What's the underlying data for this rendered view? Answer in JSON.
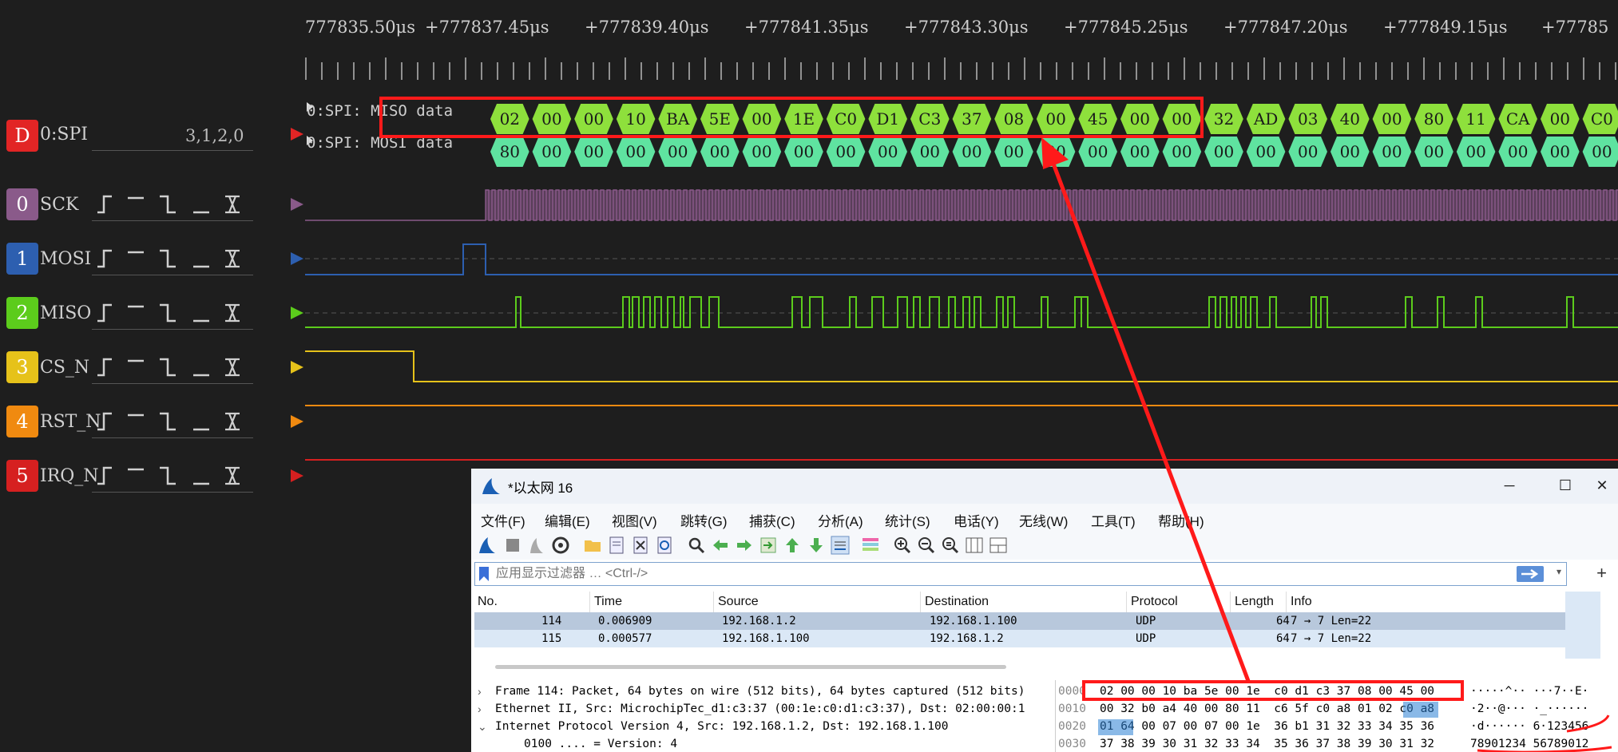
{
  "timeline": {
    "ticks": [
      "777835.50μs",
      "+777837.45μs",
      "+777839.40μs",
      "+777841.35μs",
      "+777843.30μs",
      "+777845.25μs",
      "+777847.20μs",
      "+777849.15μs",
      "+77785"
    ]
  },
  "spi_decoder": {
    "badge": "D",
    "name": "0:SPI",
    "value": "3,1,2,0",
    "miso_label": "0:SPI: MISO data",
    "mosi_label": "0:SPI: MOSI data",
    "miso_bytes": [
      "02",
      "00",
      "00",
      "10",
      "BA",
      "5E",
      "00",
      "1E",
      "C0",
      "D1",
      "C3",
      "37",
      "08",
      "00",
      "45",
      "00",
      "00",
      "32",
      "AD",
      "03",
      "40",
      "00",
      "80",
      "11",
      "CA",
      "00",
      "C0"
    ],
    "mosi_bytes": [
      "80",
      "00",
      "00",
      "00",
      "00",
      "00",
      "00",
      "00",
      "00",
      "00",
      "00",
      "00",
      "00",
      "00",
      "00",
      "00",
      "00",
      "00",
      "00",
      "00",
      "00",
      "00",
      "00",
      "00",
      "00",
      "00",
      "00"
    ]
  },
  "channels": [
    {
      "badge": "0",
      "name": "SCK",
      "color": "#8a5a8a"
    },
    {
      "badge": "1",
      "name": "MOSI",
      "color": "#2d5fb0"
    },
    {
      "badge": "2",
      "name": "MISO",
      "color": "#5ccc1c"
    },
    {
      "badge": "3",
      "name": "CS_N",
      "color": "#e6c21a"
    },
    {
      "badge": "4",
      "name": "RST_N",
      "color": "#f08a10"
    },
    {
      "badge": "5",
      "name": "IRQ_N",
      "color": "#d62020"
    }
  ],
  "colors": {
    "miso_hex": "#8ee03c",
    "mosi_hex": "#5fe3a0",
    "highlight_box": "#ff1a1a",
    "arrow": "#ff1a1a",
    "ws_selected_row": "#b8c8dc",
    "ws_row": "#dbe8f6"
  },
  "wireshark": {
    "title": "*以太网 16",
    "window_buttons": {
      "minimize": "─",
      "maximize": "☐",
      "close": "✕"
    },
    "menu": [
      "文件(F)",
      "编辑(E)",
      "视图(V)",
      "跳转(G)",
      "捕获(C)",
      "分析(A)",
      "统计(S)",
      "电话(Y)",
      "无线(W)",
      "工具(T)",
      "帮助(H)"
    ],
    "filter_placeholder": "应用显示过滤器 … <Ctrl-/>",
    "columns": [
      "No.",
      "Time",
      "Source",
      "Destination",
      "Protocol",
      "Length",
      "Info"
    ],
    "packets": [
      {
        "no": "114",
        "time": "0.006909",
        "source": "192.168.1.2",
        "destination": "192.168.1.100",
        "protocol": "UDP",
        "length": "64",
        "info": "7 → 7 Len=22"
      },
      {
        "no": "115",
        "time": "0.000577",
        "source": "192.168.1.100",
        "destination": "192.168.1.2",
        "protocol": "UDP",
        "length": "64",
        "info": "7 → 7 Len=22"
      }
    ],
    "details": [
      "Frame 114: Packet, 64 bytes on wire (512 bits), 64 bytes captured (512 bits)",
      "Ethernet II, Src: MicrochipTec_d1:c3:37 (00:1e:c0:d1:c3:37), Dst: 02:00:00:1",
      "Internet Protocol Version 4, Src: 192.168.1.2, Dst: 192.168.1.100",
      "0100 .... = Version: 4"
    ],
    "hex_rows": [
      {
        "offset": "0000",
        "bytes": "02 00 00 10 ba 5e 00 1e  c0 d1 c3 37 08 00 45 00",
        "ascii": "·····^·· ···7··E·"
      },
      {
        "offset": "0010",
        "bytes": "00 32 b0 a4 40 00 80 11  c6 5f c0 a8 01 02 c0 a8",
        "ascii": "·2··@··· ·_······"
      },
      {
        "offset": "0020",
        "bytes": "01 64 00 07 00 07 00 1e  36 b1 31 32 33 34 35 36",
        "ascii": "·d······ 6·123456"
      },
      {
        "offset": "0030",
        "bytes": "37 38 39 30 31 32 33 34  35 36 37 38 39 30 31 32",
        "ascii": "78901234 56789012"
      }
    ]
  }
}
